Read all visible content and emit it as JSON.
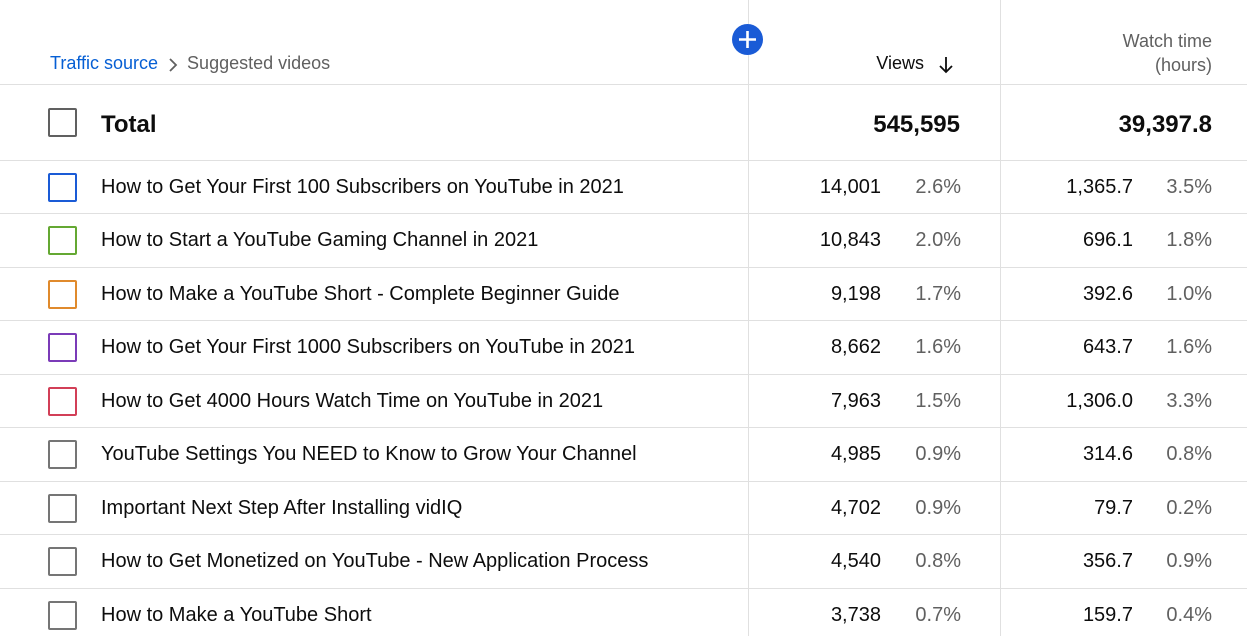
{
  "header": {
    "breadcrumb_root": "Traffic source",
    "breadcrumb_current": "Suggested videos",
    "views_label": "Views",
    "watch_time_label": "Watch time",
    "watch_time_unit": "(hours)"
  },
  "total": {
    "label": "Total",
    "views": "545,595",
    "watch_time": "39,397.8"
  },
  "colors": {
    "link": "#065fd4",
    "add_button": "#1a5bd6",
    "series": [
      "#1a5bd6",
      "#64a832",
      "#e08a2c",
      "#7b3bb8",
      "#d23f57"
    ]
  },
  "rows": [
    {
      "title": "How to Get Your First 100 Subscribers on YouTube in 2021",
      "views": "14,001",
      "views_pct": "2.6%",
      "watch": "1,365.7",
      "watch_pct": "3.5%",
      "checkbox_color": "#1a5bd6"
    },
    {
      "title": "How to Start a YouTube Gaming Channel in 2021",
      "views": "10,843",
      "views_pct": "2.0%",
      "watch": "696.1",
      "watch_pct": "1.8%",
      "checkbox_color": "#64a832"
    },
    {
      "title": "How to Make a YouTube Short - Complete Beginner Guide",
      "views": "9,198",
      "views_pct": "1.7%",
      "watch": "392.6",
      "watch_pct": "1.0%",
      "checkbox_color": "#e08a2c"
    },
    {
      "title": "How to Get Your First 1000 Subscribers on YouTube in 2021",
      "views": "8,662",
      "views_pct": "1.6%",
      "watch": "643.7",
      "watch_pct": "1.6%",
      "checkbox_color": "#7b3bb8"
    },
    {
      "title": "How to Get 4000 Hours Watch Time on YouTube in 2021",
      "views": "7,963",
      "views_pct": "1.5%",
      "watch": "1,306.0",
      "watch_pct": "3.3%",
      "checkbox_color": "#d23f57"
    },
    {
      "title": "YouTube Settings You NEED to Know to Grow Your Channel",
      "views": "4,985",
      "views_pct": "0.9%",
      "watch": "314.6",
      "watch_pct": "0.8%",
      "checkbox_color": "#757575"
    },
    {
      "title": "Important Next Step After Installing vidIQ",
      "views": "4,702",
      "views_pct": "0.9%",
      "watch": "79.7",
      "watch_pct": "0.2%",
      "checkbox_color": "#757575"
    },
    {
      "title": "How to Get Monetized on YouTube - New Application Process",
      "views": "4,540",
      "views_pct": "0.8%",
      "watch": "356.7",
      "watch_pct": "0.9%",
      "checkbox_color": "#757575"
    },
    {
      "title": "How to Make a YouTube Short",
      "views": "3,738",
      "views_pct": "0.7%",
      "watch": "159.7",
      "watch_pct": "0.4%",
      "checkbox_color": "#757575"
    }
  ]
}
